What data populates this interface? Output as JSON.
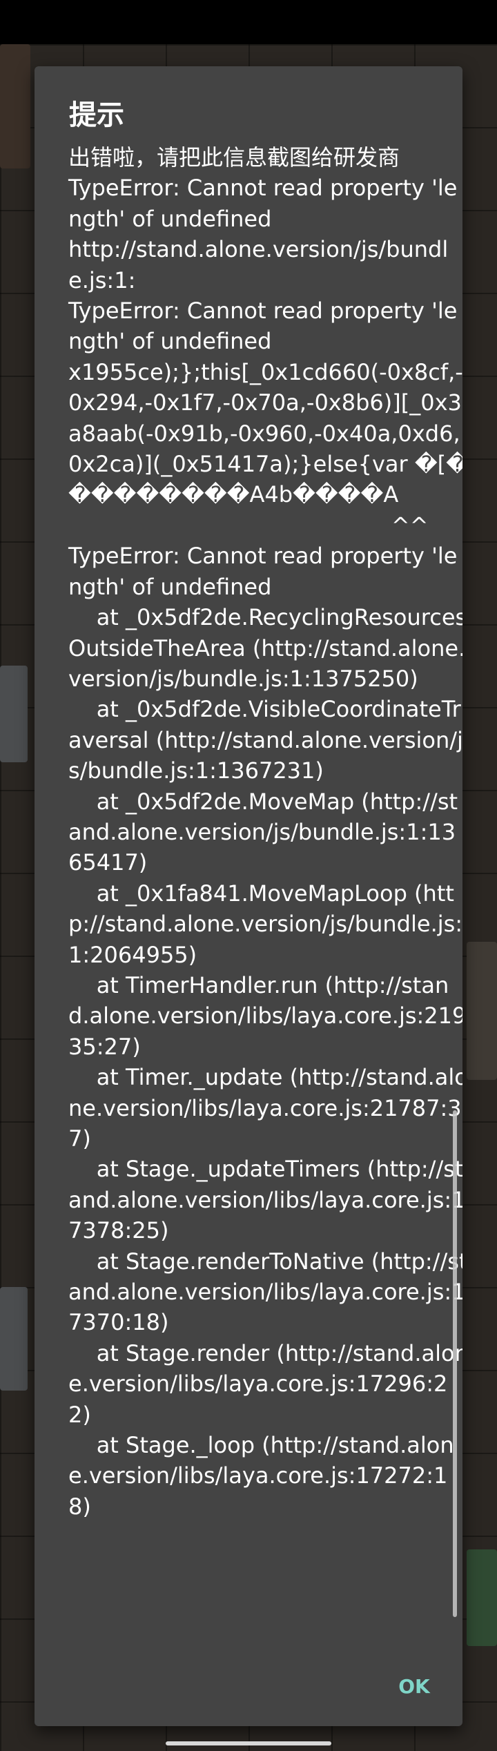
{
  "dialog": {
    "title": "提示",
    "message": "出错啦，请把此信息截图给研发商\nTypeError: Cannot read property 'length' of undefined\nhttp://stand.alone.version/js/bundle.js:1:\nTypeError: Cannot read property 'length' of undefined\nx1955ce);};this[_0x1cd660(-0x8cf,-0x294,-0x1f7,-0x70a,-0x8b6)][_0x3a8aab(-0x91b,-0x960,-0x40a,0xd6,0x2ca)](_0x51417a);}else{var �[���������A4b����A\n                                              ^^\nTypeError: Cannot read property 'length' of undefined\n    at _0x5df2de.RecyclingResourcesOutsideTheArea (http://stand.alone.version/js/bundle.js:1:1375250)\n    at _0x5df2de.VisibleCoordinateTraversal (http://stand.alone.version/js/bundle.js:1:1367231)\n    at _0x5df2de.MoveMap (http://stand.alone.version/js/bundle.js:1:1365417)\n    at _0x1fa841.MoveMapLoop (http://stand.alone.version/js/bundle.js:1:2064955)\n    at TimerHandler.run (http://stand.alone.version/libs/laya.core.js:21935:27)\n    at Timer._update (http://stand.alone.version/libs/laya.core.js:21787:37)\n    at Stage._updateTimers (http://stand.alone.version/libs/laya.core.js:17378:25)\n    at Stage.renderToNative (http://stand.alone.version/libs/laya.core.js:17370:18)\n    at Stage.render (http://stand.alone.version/libs/laya.core.js:17296:22)\n    at Stage._loop (http://stand.alone.version/libs/laya.core.js:17272:18)",
    "ok_label": "OK"
  },
  "colors": {
    "dialog_bg": "#444444",
    "text": "#ffffff",
    "accent": "#7fd6c8"
  }
}
